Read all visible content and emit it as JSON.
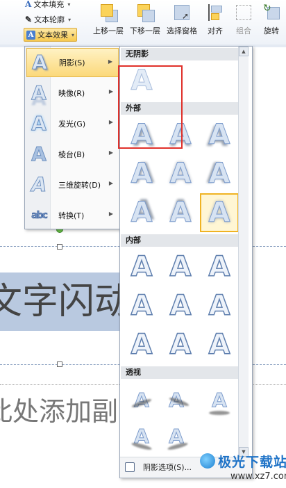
{
  "ribbon": {
    "text_fill_label": "文本填充",
    "text_outline_label": "文本轮廓",
    "text_effects_label": "文本效果",
    "bring_forward_label": "上移一层",
    "send_backward_label": "下移一层",
    "selection_pane_label": "选择窗格",
    "align_label": "对齐",
    "group_label": "组合",
    "rotate_label": "旋转"
  },
  "document": {
    "title_text": "文字闪动",
    "subtitle_text": "此处添加副"
  },
  "effects_menu": {
    "items": [
      {
        "label": "阴影(S)",
        "icon": "shadow-a-icon"
      },
      {
        "label": "映像(R)",
        "icon": "reflection-a-icon"
      },
      {
        "label": "发光(G)",
        "icon": "glow-a-icon"
      },
      {
        "label": "棱台(B)",
        "icon": "bevel-a-icon"
      },
      {
        "label": "三维旋转(D)",
        "icon": "3d-rotation-a-icon"
      },
      {
        "label": "转换(T)",
        "icon": "transform-abc-icon"
      }
    ],
    "active_index": 0
  },
  "shadow_gallery": {
    "glyph": "A",
    "sections": {
      "no_shadow": "无阴影",
      "outer": "外部",
      "inner": "内部",
      "perspective": "透视"
    },
    "selected": "outer-center",
    "footer_label": "阴影选项(S)..."
  },
  "watermark": {
    "name": "极光下载站",
    "url": "www.xz7.com"
  },
  "colors": {
    "highlight": "#fbd87a",
    "selection_border": "#f0b323",
    "annotation_red": "#e0302a",
    "text_selection": "#b9c9e0"
  }
}
